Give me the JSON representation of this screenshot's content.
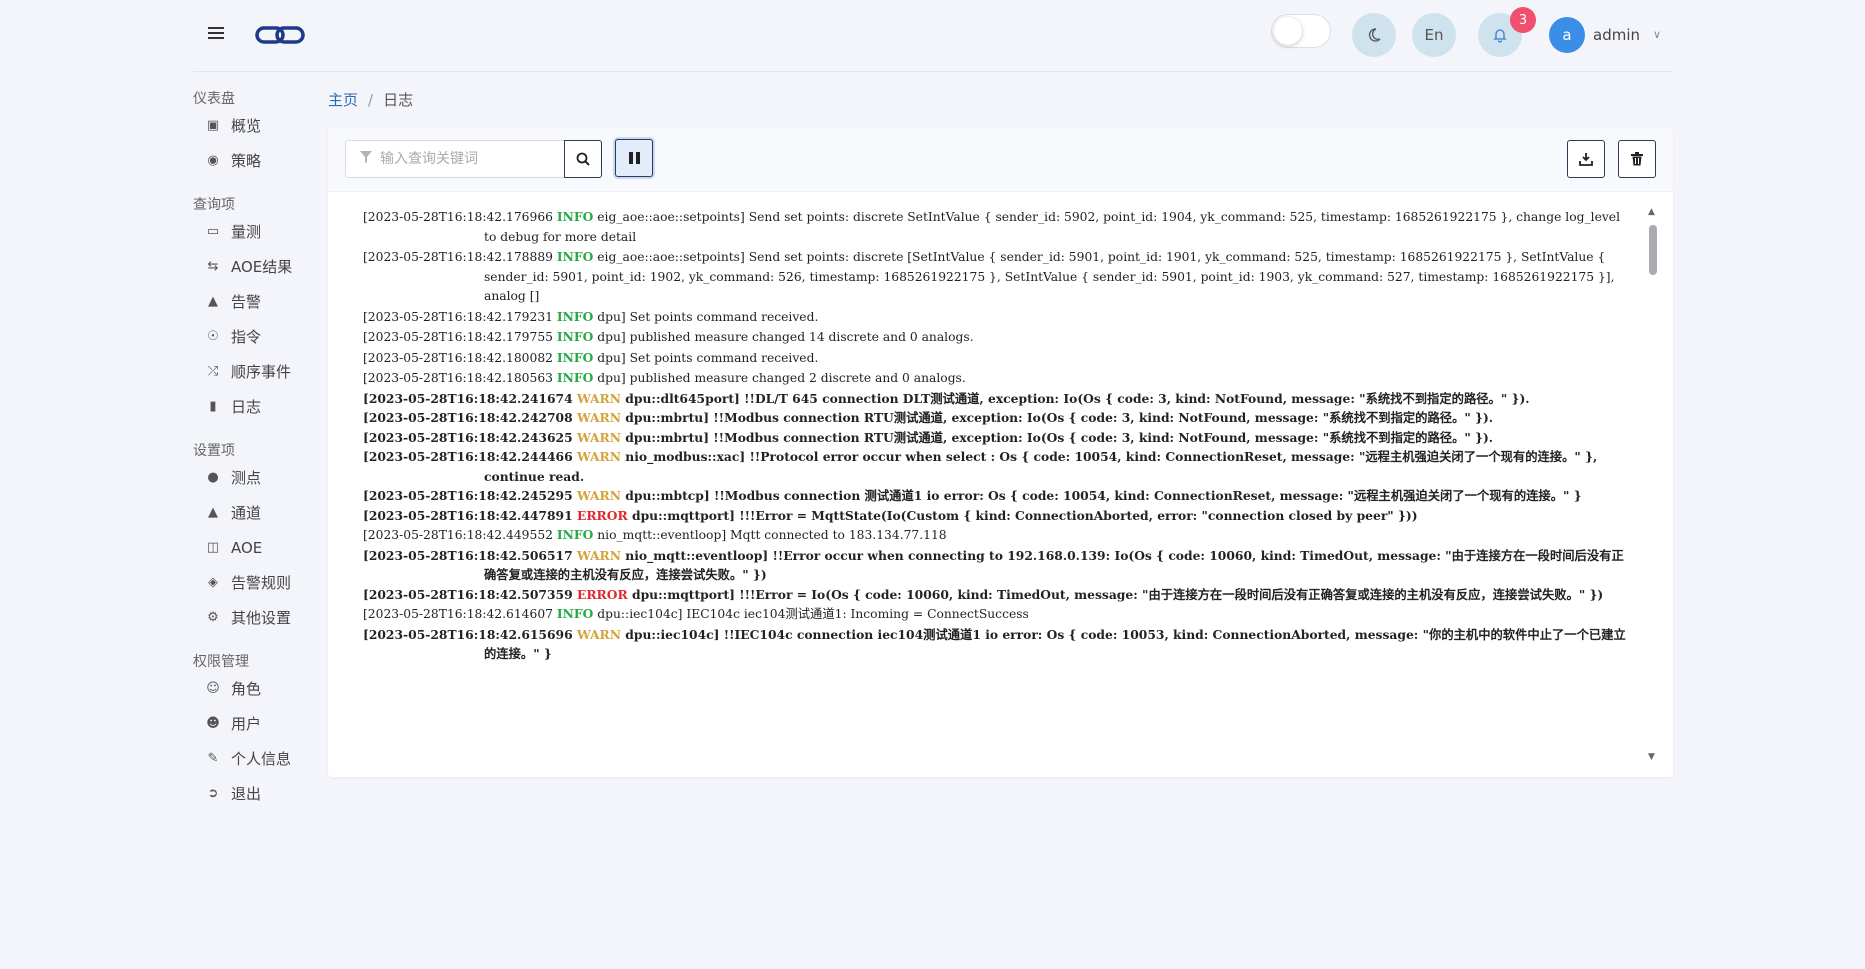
{
  "header": {
    "menu_icon": "hamburger-icon",
    "logo_icon": "link-logo-icon",
    "theme_toggle_icon": "moon-icon",
    "lang_label": "En",
    "bell_icon": "bell-icon",
    "notification_count": "3",
    "avatar_letter": "a",
    "username": "admin"
  },
  "sidebar": {
    "sections": [
      {
        "title": "仪表盘",
        "items": [
          {
            "label": "概览",
            "icon": "dashboard-icon"
          },
          {
            "label": "策略",
            "icon": "compass-icon"
          }
        ]
      },
      {
        "title": "查询项",
        "items": [
          {
            "label": "量测",
            "icon": "monitor-icon"
          },
          {
            "label": "AOE结果",
            "icon": "retweet-icon"
          },
          {
            "label": "告警",
            "icon": "megaphone-icon"
          },
          {
            "label": "指令",
            "icon": "podcast-icon"
          },
          {
            "label": "顺序事件",
            "icon": "random-icon"
          },
          {
            "label": "日志",
            "icon": "book-icon"
          }
        ]
      },
      {
        "title": "设置项",
        "items": [
          {
            "label": "测点",
            "icon": "map-pin-icon"
          },
          {
            "label": "通道",
            "icon": "road-icon"
          },
          {
            "label": "AOE",
            "icon": "network-icon"
          },
          {
            "label": "告警规则",
            "icon": "shield-icon"
          },
          {
            "label": "其他设置",
            "icon": "cogs-icon"
          }
        ]
      },
      {
        "title": "权限管理",
        "items": [
          {
            "label": "角色",
            "icon": "user-circle-icon"
          },
          {
            "label": "用户",
            "icon": "users-icon"
          },
          {
            "label": "个人信息",
            "icon": "edit-icon"
          },
          {
            "label": "退出",
            "icon": "sign-out-icon"
          }
        ]
      }
    ]
  },
  "breadcrumb": {
    "home": "主页",
    "separator": "/",
    "current": "日志"
  },
  "toolbar": {
    "search_placeholder": "输入查询关键词",
    "search_value": "",
    "search_icon": "search-icon",
    "pause_icon": "pause-icon",
    "download_icon": "download-icon",
    "delete_icon": "trash-icon"
  },
  "colors": {
    "info": "#28a745",
    "warn": "#d4a43a",
    "error": "#e0282c",
    "accent": "#2b6cb0"
  },
  "logs": [
    {
      "ts": "[2023-05-28T16:18:42.176966",
      "level": "INFO",
      "bold": false,
      "msg": " eig_aoe::aoe::setpoints] Send set points: discrete SetIntValue { sender_id: 5902, point_id: 1904, yk_command: 525, timestamp: 1685261922175 }, change log_level to debug for more detail"
    },
    {
      "ts": "[2023-05-28T16:18:42.178889",
      "level": "INFO",
      "bold": false,
      "msg": " eig_aoe::aoe::setpoints] Send set points: discrete [SetIntValue { sender_id: 5901, point_id: 1901, yk_command: 525, timestamp: 1685261922175 }, SetIntValue { sender_id: 5901, point_id: 1902, yk_command: 526, timestamp: 1685261922175 }, SetIntValue { sender_id: 5901, point_id: 1903, yk_command: 527, timestamp: 1685261922175 }], analog []"
    },
    {
      "ts": "[2023-05-28T16:18:42.179231",
      "level": "INFO",
      "bold": false,
      "msg": " dpu] Set points command received."
    },
    {
      "ts": "[2023-05-28T16:18:42.179755",
      "level": "INFO",
      "bold": false,
      "msg": " dpu] published measure changed 14 discrete and 0 analogs."
    },
    {
      "ts": "[2023-05-28T16:18:42.180082",
      "level": "INFO",
      "bold": false,
      "msg": " dpu] Set points command received."
    },
    {
      "ts": "[2023-05-28T16:18:42.180563",
      "level": "INFO",
      "bold": false,
      "msg": " dpu] published measure changed 2 discrete and 0 analogs."
    },
    {
      "ts": "[2023-05-28T16:18:42.241674",
      "level": "WARN",
      "bold": true,
      "msg": " dpu::dlt645port] !!DL/T 645 connection DLT测试通道, exception: Io(Os { code: 3, kind: NotFound, message: \"系统找不到指定的路径。\" })."
    },
    {
      "ts": "[2023-05-28T16:18:42.242708",
      "level": "WARN",
      "bold": true,
      "msg": " dpu::mbrtu] !!Modbus connection RTU测试通道, exception: Io(Os { code: 3, kind: NotFound, message: \"系统找不到指定的路径。\" })."
    },
    {
      "ts": "[2023-05-28T16:18:42.243625",
      "level": "WARN",
      "bold": true,
      "msg": " dpu::mbrtu] !!Modbus connection RTU测试通道, exception: Io(Os { code: 3, kind: NotFound, message: \"系统找不到指定的路径。\" })."
    },
    {
      "ts": "[2023-05-28T16:18:42.244466",
      "level": "WARN",
      "bold": true,
      "msg": " nio_modbus::xac] !!Protocol error occur when select : Os { code: 10054, kind: ConnectionReset, message: \"远程主机强迫关闭了一个现有的连接。\" }, continue read."
    },
    {
      "ts": "[2023-05-28T16:18:42.245295",
      "level": "WARN",
      "bold": true,
      "msg": " dpu::mbtcp] !!Modbus connection 测试通道1 io error: Os { code: 10054, kind: ConnectionReset, message: \"远程主机强迫关闭了一个现有的连接。\" }"
    },
    {
      "ts": "[2023-05-28T16:18:42.447891",
      "level": "ERROR",
      "bold": true,
      "msg": " dpu::mqttport] !!!Error = MqttState(Io(Custom { kind: ConnectionAborted, error: \"connection closed by peer\" }))"
    },
    {
      "ts": "[2023-05-28T16:18:42.449552",
      "level": "INFO",
      "bold": false,
      "msg": " nio_mqtt::eventloop] Mqtt connected to 183.134.77.118"
    },
    {
      "ts": "[2023-05-28T16:18:42.506517",
      "level": "WARN",
      "bold": true,
      "msg": " nio_mqtt::eventloop] !!Error occur when connecting to 192.168.0.139: Io(Os { code: 10060, kind: TimedOut, message: \"由于连接方在一段时间后没有正确答复或连接的主机没有反应，连接尝试失败。\" })"
    },
    {
      "ts": "[2023-05-28T16:18:42.507359",
      "level": "ERROR",
      "bold": true,
      "msg": " dpu::mqttport] !!!Error = Io(Os { code: 10060, kind: TimedOut, message: \"由于连接方在一段时间后没有正确答复或连接的主机没有反应，连接尝试失败。\" })"
    },
    {
      "ts": "[2023-05-28T16:18:42.614607",
      "level": "INFO",
      "bold": false,
      "msg": " dpu::iec104c] IEC104c iec104测试通道1: Incoming = ConnectSuccess"
    },
    {
      "ts": "[2023-05-28T16:18:42.615696",
      "level": "WARN",
      "bold": true,
      "msg": " dpu::iec104c] !!IEC104c connection iec104测试通道1 io error: Os { code: 10053, kind: ConnectionAborted, message: \"你的主机中的软件中止了一个已建立的连接。\" }"
    }
  ]
}
